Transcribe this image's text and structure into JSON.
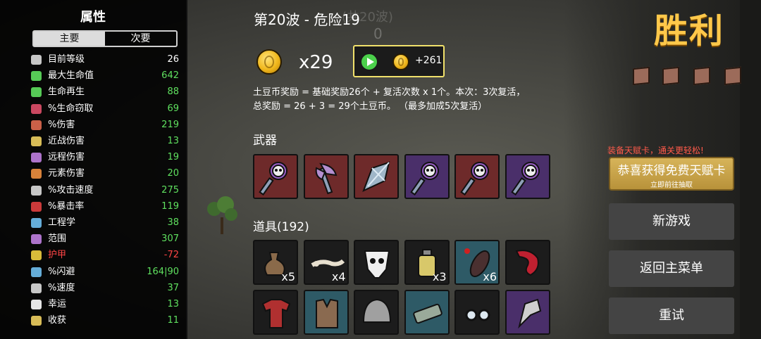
{
  "stats": {
    "title": "属性",
    "tab_primary": "主要",
    "tab_secondary": "次要",
    "rows": [
      {
        "label": "目前等级",
        "value": "26",
        "color": "white",
        "icon": "level-icon"
      },
      {
        "label": "最大生命值",
        "value": "642",
        "color": "green",
        "icon": "heart-icon"
      },
      {
        "label": "生命再生",
        "value": "88",
        "color": "green",
        "icon": "heart-plus-icon"
      },
      {
        "label": "%生命窃取",
        "value": "69",
        "color": "green",
        "icon": "fangs-icon"
      },
      {
        "label": "%伤害",
        "value": "219",
        "color": "green",
        "icon": "muscle-icon"
      },
      {
        "label": "近战伤害",
        "value": "13",
        "color": "green",
        "icon": "sword-icon"
      },
      {
        "label": "远程伤害",
        "value": "19",
        "color": "green",
        "icon": "bow-icon"
      },
      {
        "label": "元素伤害",
        "value": "20",
        "color": "green",
        "icon": "flame-icon"
      },
      {
        "label": "%攻击速度",
        "value": "275",
        "color": "green",
        "icon": "hourglass-icon"
      },
      {
        "label": "%暴击率",
        "value": "119",
        "color": "green",
        "icon": "crit-icon"
      },
      {
        "label": "工程学",
        "value": "38",
        "color": "green",
        "icon": "wrench-icon"
      },
      {
        "label": "范围",
        "value": "307",
        "color": "green",
        "icon": "range-icon"
      },
      {
        "label": "护甲",
        "value": "-72",
        "color": "red",
        "icon": "shield-icon"
      },
      {
        "label": "%闪避",
        "value": "164|90",
        "color": "green",
        "icon": "dodge-icon"
      },
      {
        "label": "%速度",
        "value": "37",
        "color": "green",
        "icon": "boot-icon"
      },
      {
        "label": "幸运",
        "value": "13",
        "color": "green",
        "icon": "dice-icon"
      },
      {
        "label": "收获",
        "value": "11",
        "color": "green",
        "icon": "wheat-icon"
      }
    ]
  },
  "wave": {
    "title": "第20波 - 危险19",
    "ghost": "(共20波)",
    "ghost_zero": "0"
  },
  "reward": {
    "coin_count": "x29",
    "bonus": "+261",
    "explain_line1": "土豆币奖励 = 基础奖励26个 + 复活次数 x 1个。本次：3次复活，",
    "explain_line2": "总奖励 = 26 + 3 = 29个土豆币。 （最多加成5次复活）"
  },
  "weapons": {
    "label": "武器",
    "items": [
      {
        "bg": "red",
        "icon": "skull-wand-icon"
      },
      {
        "bg": "red",
        "icon": "axe-icon"
      },
      {
        "bg": "red",
        "icon": "crystal-icon"
      },
      {
        "bg": "purple",
        "icon": "skull-wand-icon"
      },
      {
        "bg": "red",
        "icon": "skull-wand-icon"
      },
      {
        "bg": "purple",
        "icon": "skull-wand-icon"
      }
    ]
  },
  "items": {
    "label": "道具(192)",
    "row1": [
      {
        "bg": "dark",
        "icon": "sack-icon",
        "qty": "x5"
      },
      {
        "bg": "dark",
        "icon": "lizard-icon",
        "qty": "x4"
      },
      {
        "bg": "dark",
        "icon": "bone-skull-icon",
        "qty": ""
      },
      {
        "bg": "dark",
        "icon": "potion-icon",
        "qty": "x3"
      },
      {
        "bg": "teal",
        "icon": "leech-icon",
        "qty": "x6"
      },
      {
        "bg": "dark",
        "icon": "tongue-icon",
        "qty": ""
      }
    ],
    "row2": [
      {
        "bg": "dark",
        "icon": "shirt-icon"
      },
      {
        "bg": "teal",
        "icon": "vest-icon"
      },
      {
        "bg": "dark",
        "icon": "helmet-icon"
      },
      {
        "bg": "teal",
        "icon": "gear-belt-icon"
      },
      {
        "bg": "dark",
        "icon": "glasses-icon"
      },
      {
        "bg": "purple",
        "icon": "claw-icon"
      }
    ]
  },
  "right": {
    "victory": "胜利",
    "talent_promo": "装备天赋卡，通关更轻松!",
    "talent_main": "恭喜获得免费天赋卡",
    "talent_sub": "立即前往抽取",
    "new_game": "新游戏",
    "main_menu": "返回主菜单",
    "retry": "重试"
  }
}
